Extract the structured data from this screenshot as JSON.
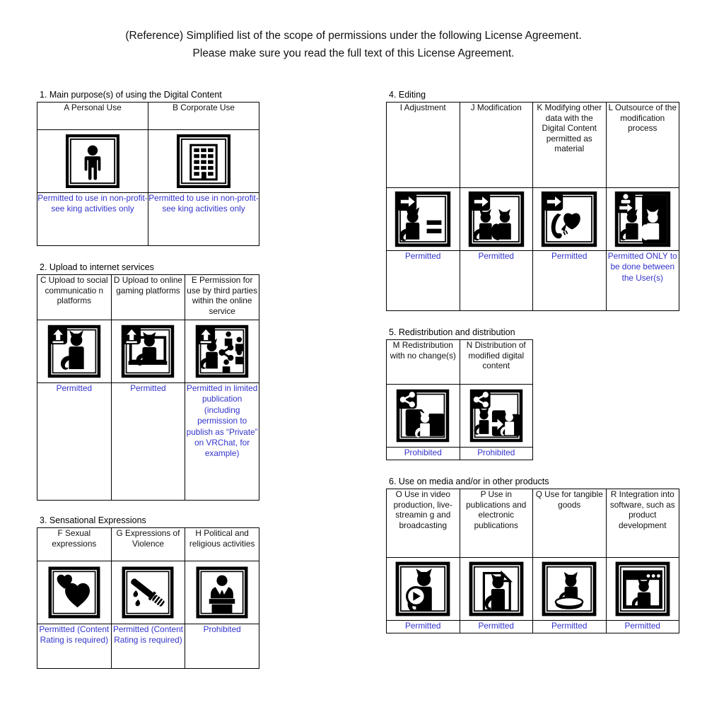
{
  "heading": {
    "line1": "(Reference) Simplified list of the scope of permissions under the following License Agreement.",
    "line2": "Please make sure you read the full text of this License Agreement."
  },
  "colors": {
    "permission_text": "#3333cc",
    "header_text": "#111111",
    "border": "#000000",
    "background": "#ffffff"
  },
  "sections": [
    {
      "id": "section-1",
      "title": "1. Main purpose(s) of using the Digital Content",
      "columns": [
        {
          "code": "A",
          "header": "A Personal Use",
          "icon": "person-icon",
          "permission": "Permitted to use in non-profit-see king activities only"
        },
        {
          "code": "B",
          "header": "B  Corporate Use",
          "icon": "office-building-icon",
          "permission": "Permitted to use in non-profit-see king activities only"
        }
      ]
    },
    {
      "id": "section-2",
      "title": "2. Upload to internet services",
      "columns": [
        {
          "code": "C",
          "header": "C Upload to social communicatio n platforms",
          "icon": "upload-cat-icon",
          "permission": "Permitted"
        },
        {
          "code": "D",
          "header": "D Upload to online gaming platforms",
          "icon": "upload-cat-monitor-icon",
          "permission": "Permitted"
        },
        {
          "code": "E",
          "header": "E Permission for use by third parties within the online service",
          "icon": "upload-cat-share-people-icon",
          "permission": "Permitted in limited publication (including permission to publish as “Private” on VRChat, for example)"
        }
      ]
    },
    {
      "id": "section-3",
      "title": "3. Sensational Expressions",
      "columns": [
        {
          "code": "F",
          "header": "F Sexual expressions",
          "icon": "two-hearts-icon",
          "permission": "Permitted (Content Rating is required)"
        },
        {
          "code": "G",
          "header": "G Expressions of Violence",
          "icon": "bloody-knife-icon",
          "permission": "Permitted (Content Rating is required)"
        },
        {
          "code": "H",
          "header": "H Political and religious activities",
          "icon": "speaker-podium-icon",
          "permission": "Prohibited"
        }
      ]
    },
    {
      "id": "section-4",
      "title": "4. Editing",
      "columns": [
        {
          "code": "I",
          "header": "I Adjustment",
          "icon": "arrow-cat-equals-icon",
          "permission": "Permitted"
        },
        {
          "code": "J",
          "header": "J Modification",
          "icon": "arrow-cat-to-cat-icon",
          "permission": "Permitted"
        },
        {
          "code": "K",
          "header": "K Modifying other data with the Digital Content permitted as material",
          "icon": "arrow-cat-tail-ribbon-icon",
          "permission": "Permitted"
        },
        {
          "code": "L",
          "header": "L Outsource of the modification process",
          "icon": "handoff-two-cats-icon",
          "permission": "Permitted ONLY to be done between the User(s)"
        }
      ]
    },
    {
      "id": "section-5",
      "title": "5. Redistribution and distribution",
      "columns": [
        {
          "code": "M",
          "header": "M Redistribution with no change(s)",
          "icon": "share-folder-cat-icon",
          "permission": "Prohibited"
        },
        {
          "code": "N",
          "header": "N Distribution of modified digital content",
          "icon": "share-folder-modified-cat-icon",
          "permission": "Prohibited"
        }
      ]
    },
    {
      "id": "section-6",
      "title": "6. Use on media and/or in other products",
      "columns": [
        {
          "code": "O",
          "header": "O Use in video production, live-streamin g and broadcasting",
          "icon": "cat-play-button-icon",
          "permission": "Permitted"
        },
        {
          "code": "P",
          "header": "P Use in publications and electronic publications",
          "icon": "cat-document-icon",
          "permission": "Permitted"
        },
        {
          "code": "Q",
          "header": "Q Use for tangible goods",
          "icon": "cat-figurine-icon",
          "permission": "Permitted"
        },
        {
          "code": "R",
          "header": "R Integration into software, such as product development",
          "icon": "cat-app-window-icon",
          "permission": "Permitted"
        }
      ]
    }
  ]
}
